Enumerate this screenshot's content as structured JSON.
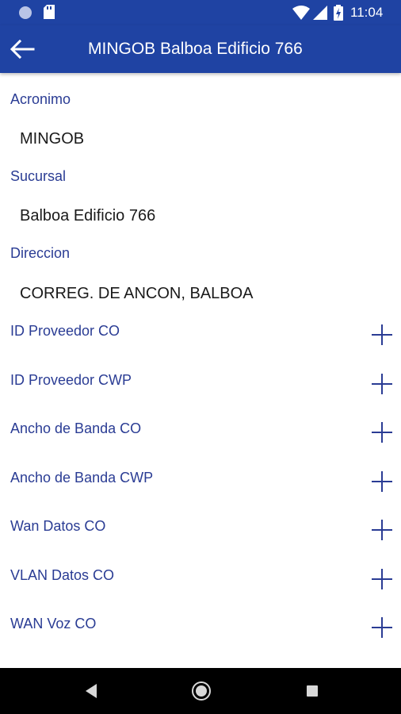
{
  "status_bar": {
    "time": "11:04",
    "icons": [
      "notification-dot-icon",
      "sd-card-icon",
      "wifi-icon",
      "signal-icon",
      "battery-charging-icon"
    ]
  },
  "app_bar": {
    "back_icon": "arrow-left-icon",
    "title": "MINGOB Balboa Edificio 766"
  },
  "fields": [
    {
      "label": "Acronimo",
      "value": "MINGOB"
    },
    {
      "label": "Sucursal",
      "value": "Balboa Edificio 766"
    },
    {
      "label": "Direccion",
      "value": "CORREG. DE ANCON, BALBOA"
    }
  ],
  "expandable_rows": [
    {
      "label": "ID Proveedor CO",
      "icon": "plus-icon"
    },
    {
      "label": "ID Proveedor CWP",
      "icon": "plus-icon"
    },
    {
      "label": "Ancho de Banda CO",
      "icon": "plus-icon"
    },
    {
      "label": "Ancho de Banda CWP",
      "icon": "plus-icon"
    },
    {
      "label": "Wan Datos CO",
      "icon": "plus-icon"
    },
    {
      "label": "VLAN Datos CO",
      "icon": "plus-icon"
    },
    {
      "label": "WAN Voz CO",
      "icon": "plus-icon"
    }
  ],
  "nav_bar": {
    "icons": [
      "back-triangle-icon",
      "home-circle-icon",
      "recents-square-icon"
    ]
  },
  "colors": {
    "primary": "#1f43a3",
    "label": "#2a3c94",
    "value_text": "#1a1a1a",
    "background": "#ffffff"
  }
}
